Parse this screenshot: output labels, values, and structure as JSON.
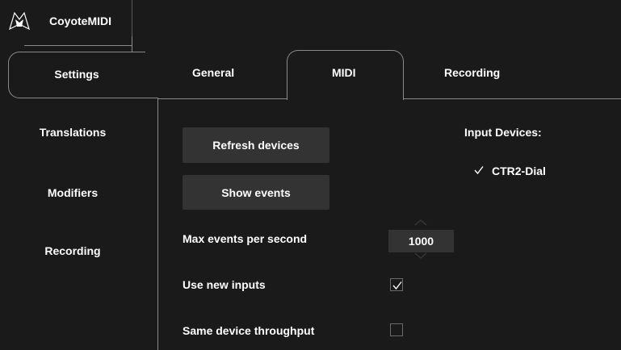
{
  "app": {
    "title": "CoyoteMIDI",
    "icon": "coyote-logo-icon"
  },
  "sidebar": {
    "items": [
      {
        "label": "Settings",
        "selected": true
      },
      {
        "label": "Translations",
        "selected": false
      },
      {
        "label": "Modifiers",
        "selected": false
      },
      {
        "label": "Recording",
        "selected": false
      }
    ]
  },
  "tabs": [
    {
      "label": "General",
      "selected": false
    },
    {
      "label": "MIDI",
      "selected": true
    },
    {
      "label": "Recording",
      "selected": false
    }
  ],
  "midi": {
    "refresh_label": "Refresh devices",
    "show_events_label": "Show events",
    "max_events_label": "Max events per second",
    "max_events_value": "1000",
    "use_new_inputs_label": "Use new inputs",
    "use_new_inputs_checked": true,
    "same_device_label": "Same device throughput",
    "same_device_checked": false,
    "input_devices_title": "Input Devices:",
    "devices": [
      {
        "name": "CTR2-Dial",
        "checked": true
      }
    ]
  },
  "colors": {
    "background": "#1a1a1a",
    "button": "#333333",
    "outline": "#8a8a8a",
    "text": "#ffffff"
  }
}
